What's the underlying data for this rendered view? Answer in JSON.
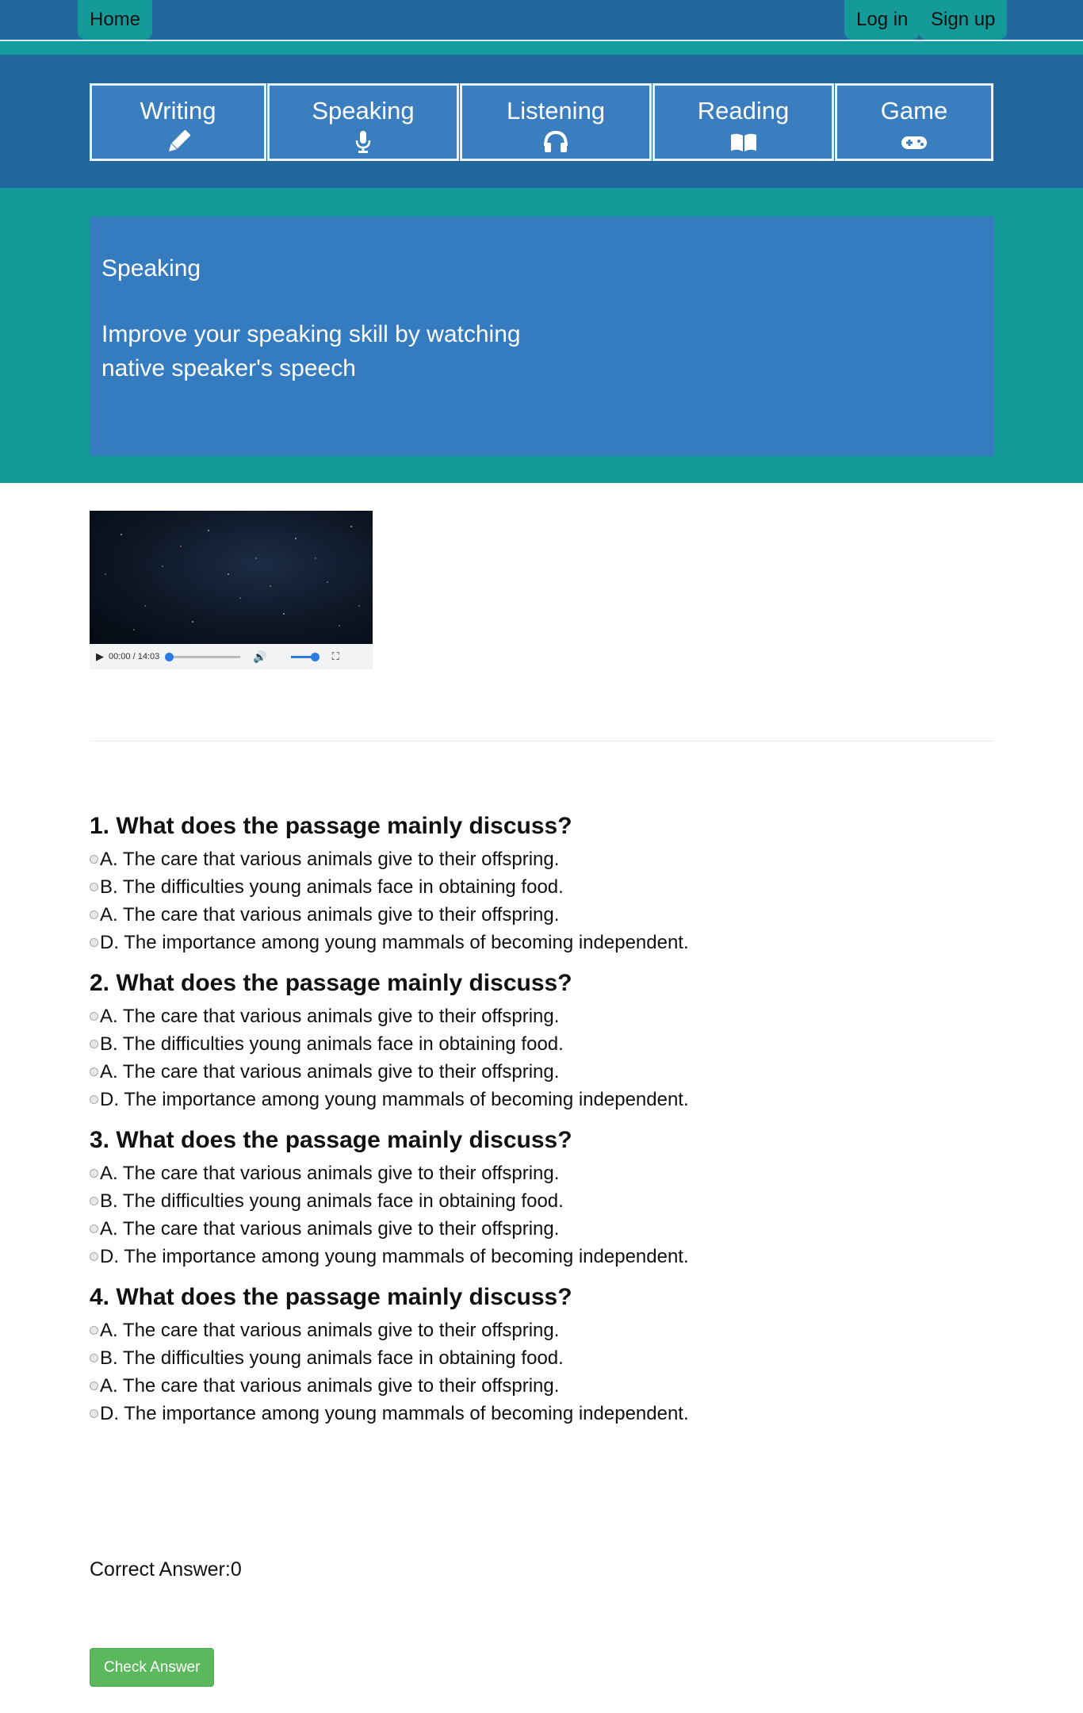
{
  "header": {
    "home": "Home",
    "login": "Log in",
    "signup": "Sign up"
  },
  "categories": [
    {
      "label": "Writing",
      "icon": "pencil-icon"
    },
    {
      "label": "Speaking",
      "icon": "microphone-icon"
    },
    {
      "label": "Listening",
      "icon": "headphones-icon"
    },
    {
      "label": "Reading",
      "icon": "book-icon"
    },
    {
      "label": "Game",
      "icon": "gamepad-icon"
    }
  ],
  "hero": {
    "title": "Speaking",
    "subtitle": "Improve your speaking skill by watching native speaker's speech"
  },
  "video": {
    "time": "00:00 / 14:03",
    "progress": 0.0,
    "volume": 1.0
  },
  "questions": [
    {
      "title": "1. What does the passage mainly discuss?",
      "options": [
        "A. The care that various animals give to their offspring.",
        "B. The difficulties young animals face in obtaining food.",
        "A. The care that various animals give to their offspring.",
        "D. The importance among young mammals of becoming independent."
      ]
    },
    {
      "title": "2. What does the passage mainly discuss?",
      "options": [
        "A. The care that various animals give to their offspring.",
        "B. The difficulties young animals face in obtaining food.",
        "A. The care that various animals give to their offspring.",
        "D. The importance among young mammals of becoming independent."
      ]
    },
    {
      "title": "3. What does the passage mainly discuss?",
      "options": [
        "A. The care that various animals give to their offspring.",
        "B. The difficulties young animals face in obtaining food.",
        "A. The care that various animals give to their offspring.",
        "D. The importance among young mammals of becoming independent."
      ]
    },
    {
      "title": "4. What does the passage mainly discuss?",
      "options": [
        "A. The care that various animals give to their offspring.",
        "B. The difficulties young animals face in obtaining food.",
        "A. The care that various animals give to their offspring.",
        "D. The importance among young mammals of becoming independent."
      ]
    }
  ],
  "result": {
    "correct_answer": "Correct Answer:0"
  },
  "actions": {
    "check_answer": "Check Answer"
  },
  "colors": {
    "nav_blue": "#23679f",
    "teal": "#149a99",
    "tile_blue": "#3a7ebf",
    "hero_blue": "#347bc0",
    "button_green": "#5cb85c"
  }
}
